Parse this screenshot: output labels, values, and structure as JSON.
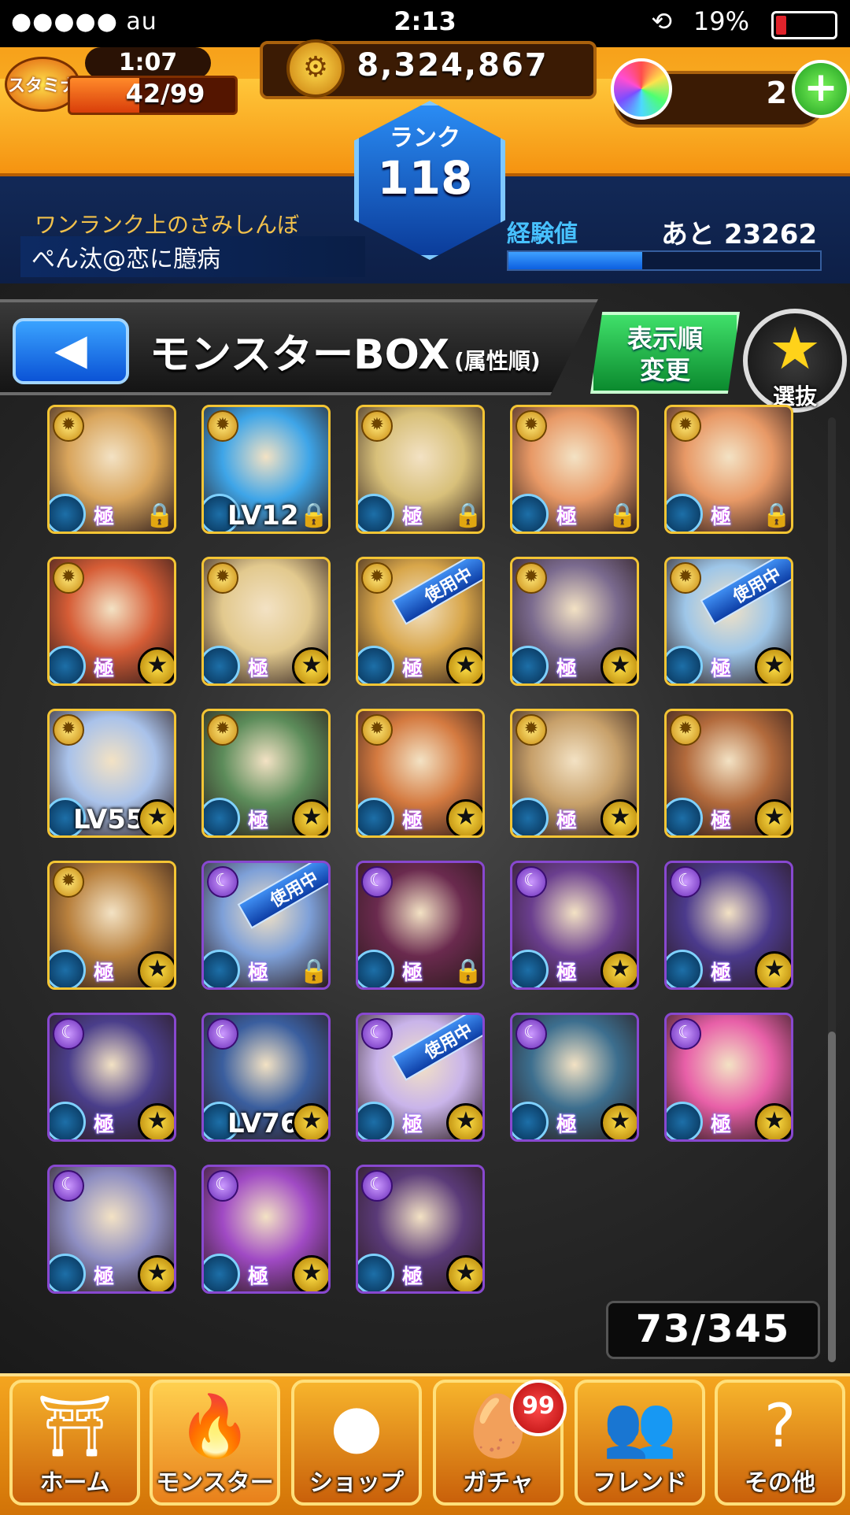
{
  "status_bar": {
    "carrier": "●●●●● au",
    "time": "2:13",
    "battery": "19%",
    "battery_level": 0.19
  },
  "header": {
    "stamina_label": "スタミナ",
    "stamina_timer": "1:07",
    "stamina_value": "42/99",
    "stamina_fraction": 0.42,
    "gold": "8,324,867",
    "orbs": "2",
    "rank_label": "ランク",
    "rank": "118",
    "title": "ワンランク上のさみしんぼ",
    "player_name": "ぺん汰@恋に臆病",
    "exp_label": "経験値",
    "exp_next": "あと 23262",
    "exp_fraction": 0.43
  },
  "box": {
    "back_label": "◀",
    "title": "モンスターBOX",
    "subtitle": "(属性順)",
    "sort_label_1": "表示順",
    "sort_label_2": "変更",
    "select_label": "選抜",
    "count": "73/345"
  },
  "cards": [
    {
      "attr": "light",
      "art": "#d9a55c",
      "mark": "lock"
    },
    {
      "attr": "light",
      "art": "#3ea5e8",
      "mark": "lock",
      "lv": "LV12"
    },
    {
      "attr": "light",
      "art": "#d8c07a",
      "mark": "lock"
    },
    {
      "attr": "light",
      "art": "#e89966",
      "mark": "lock"
    },
    {
      "attr": "light",
      "art": "#e89966",
      "mark": "lock"
    },
    {
      "attr": "light",
      "art": "#d65d36",
      "mark": "star"
    },
    {
      "attr": "light",
      "art": "#e2c98e",
      "mark": "star"
    },
    {
      "attr": "light",
      "art": "#d8a64a",
      "mark": "star",
      "inuse": "使用中"
    },
    {
      "attr": "light",
      "art": "#7a6a8e",
      "mark": "star"
    },
    {
      "attr": "light",
      "art": "#9ec6e8",
      "mark": "star",
      "inuse": "使用中"
    },
    {
      "attr": "light",
      "art": "#a9c2ea",
      "mark": "star",
      "lv": "LV55"
    },
    {
      "attr": "light",
      "art": "#5c8c5a",
      "mark": "star"
    },
    {
      "attr": "light",
      "art": "#d47a40",
      "mark": "star"
    },
    {
      "attr": "light",
      "art": "#c7a06a",
      "mark": "star"
    },
    {
      "attr": "light",
      "art": "#b26a3c",
      "mark": "star"
    },
    {
      "attr": "light",
      "art": "#b9813e",
      "mark": "star"
    },
    {
      "attr": "dark",
      "art": "#7ea0d8",
      "mark": "lock",
      "inuse": "使用中"
    },
    {
      "attr": "dark",
      "art": "#6a2a4e",
      "mark": "lock"
    },
    {
      "attr": "dark",
      "art": "#6a3e8e",
      "mark": "star"
    },
    {
      "attr": "dark",
      "art": "#4b3a8c",
      "mark": "star"
    },
    {
      "attr": "dark",
      "art": "#4a3e8a",
      "mark": "star"
    },
    {
      "attr": "dark",
      "art": "#3a5e9e",
      "mark": "star",
      "lv": "LV76"
    },
    {
      "attr": "dark",
      "art": "#c9b4ea",
      "mark": "star",
      "inuse": "使用中"
    },
    {
      "attr": "dark",
      "art": "#3c6e8e",
      "mark": "star"
    },
    {
      "attr": "dark",
      "art": "#e860a8",
      "mark": "star"
    },
    {
      "attr": "dark",
      "art": "#8e8ec2",
      "mark": "star"
    },
    {
      "attr": "dark",
      "art": "#a04ac4",
      "mark": "star"
    },
    {
      "attr": "dark",
      "art": "#5a3a78",
      "mark": "star"
    }
  ],
  "card_label": "極",
  "nav": [
    {
      "label": "ホーム",
      "glyph": "⛩"
    },
    {
      "label": "モンスター",
      "glyph": "🔥"
    },
    {
      "label": "ショップ",
      "glyph": "●"
    },
    {
      "label": "ガチャ",
      "glyph": "🥚"
    },
    {
      "label": "フレンド",
      "glyph": "👥"
    },
    {
      "label": "その他",
      "glyph": "?"
    }
  ],
  "gacha_badge": "99",
  "colors": {
    "gold": "#f4c534",
    "dark_attr": "#8848d0",
    "header_orange": "#f59310"
  }
}
